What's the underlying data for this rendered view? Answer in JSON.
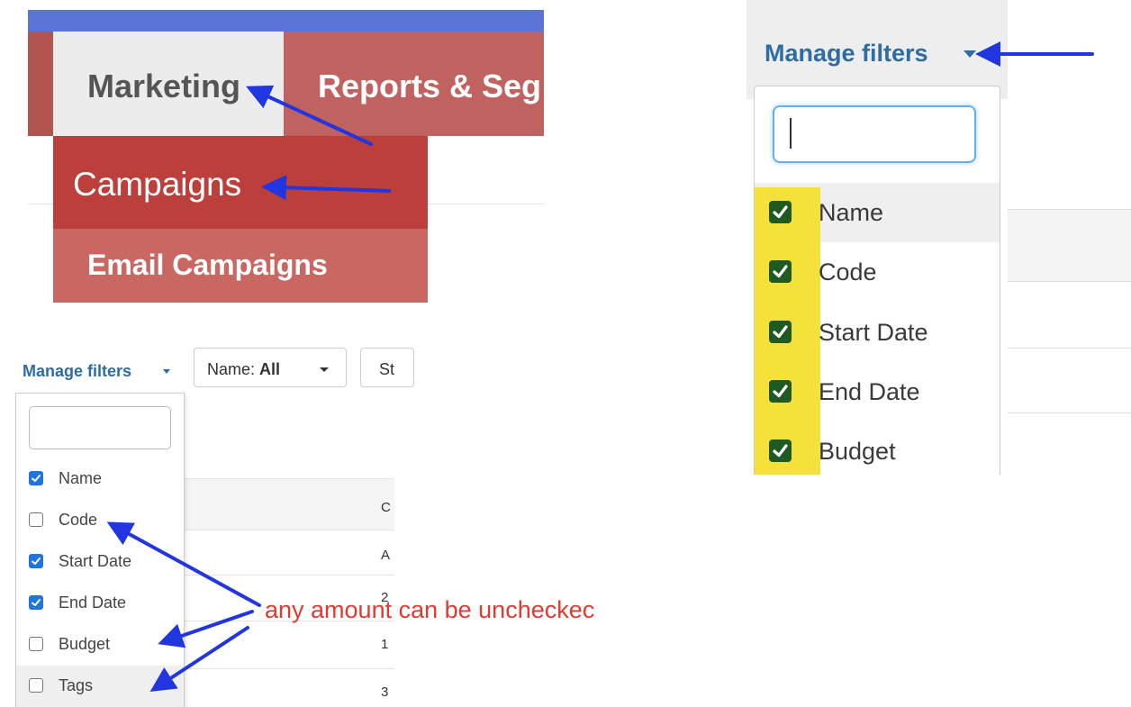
{
  "colors": {
    "nav_red": "#c0625f",
    "dropdown_red": "#bc3f3b",
    "top_bar_blue": "#5b74d8",
    "link_blue": "#2e6da4",
    "check_green": "#1f5a21",
    "check_blue": "#1f74e0",
    "highlight_yellow": "#f5e13a",
    "annotation_red": "#e03a31",
    "arrow_blue": "#2136e0"
  },
  "panel_nav": {
    "tabs": [
      {
        "label": "Marketing",
        "active": true
      },
      {
        "label": "Reports & Seg"
      }
    ],
    "dropdown": [
      {
        "label": "Campaigns",
        "active": true
      },
      {
        "label": "Email Campaigns"
      }
    ]
  },
  "panel_filters_large": {
    "button_label": "Manage filters",
    "search_value": "",
    "items": [
      {
        "label": "Name",
        "checked": true
      },
      {
        "label": "Code",
        "checked": true
      },
      {
        "label": "Start Date",
        "checked": true
      },
      {
        "label": "End Date",
        "checked": true
      },
      {
        "label": "Budget",
        "checked": true
      }
    ]
  },
  "panel_filters_small": {
    "button_label": "Manage filters",
    "name_filter_prefix": "Name: ",
    "name_filter_value": "All",
    "next_filter_label": "St",
    "search_value": "",
    "items": [
      {
        "label": "Name",
        "checked": true
      },
      {
        "label": "Code",
        "checked": false
      },
      {
        "label": "Start Date",
        "checked": true
      },
      {
        "label": "End Date",
        "checked": true
      },
      {
        "label": "Budget",
        "checked": false
      },
      {
        "label": "Tags",
        "checked": false
      }
    ],
    "table": {
      "column_header": "C",
      "cells": [
        "A",
        "2",
        "1",
        "3"
      ]
    }
  },
  "annotation": "any amount can be uncheckec"
}
